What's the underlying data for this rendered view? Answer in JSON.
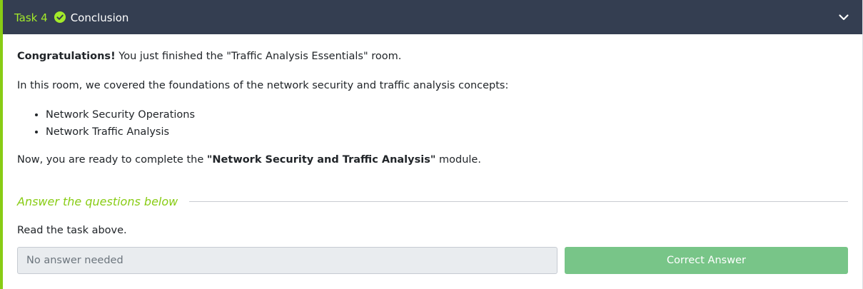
{
  "header": {
    "task_label": "Task 4",
    "title": "Conclusion",
    "icons": {
      "completed": "check-circle-icon",
      "toggle": "chevron-down-icon"
    }
  },
  "content": {
    "intro_bold": "Congratulations!",
    "intro_rest": " You just finished the \"Traffic Analysis Essentials\" room.",
    "paragraph2": "In this room, we covered the foundations of the network security and traffic analysis concepts:",
    "topics": [
      "Network Security Operations",
      "Network Traffic Analysis"
    ],
    "closing_prefix": "Now, you are ready to complete the ",
    "closing_bold": "\"Network Security and Traffic Analysis\"",
    "closing_suffix": " module."
  },
  "questions": {
    "heading": "Answer the questions below",
    "items": [
      {
        "text": "Read the task above.",
        "answer_value": "No answer needed",
        "button_label": "Correct Answer"
      }
    ]
  },
  "colors": {
    "accent_green": "#88cc14",
    "task_label_green": "#a3ea2a",
    "header_bg": "#343e51",
    "correct_button": "#78c588",
    "input_bg": "#e9ecef"
  }
}
